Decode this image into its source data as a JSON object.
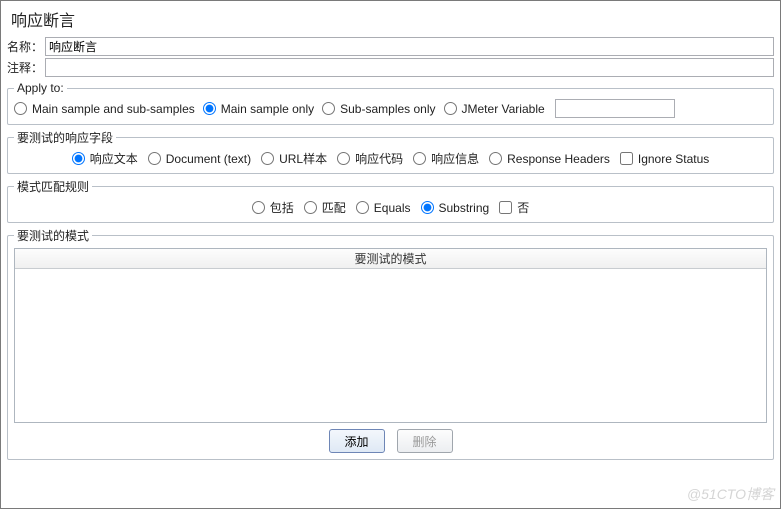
{
  "title": "响应断言",
  "fields": {
    "name_label": "名称：",
    "name_value": "响应断言",
    "comment_label": "注释：",
    "comment_value": ""
  },
  "apply_to": {
    "legend": "Apply to:",
    "options": [
      {
        "label": "Main sample and sub-samples",
        "selected": false
      },
      {
        "label": "Main sample only",
        "selected": true
      },
      {
        "label": "Sub-samples only",
        "selected": false
      },
      {
        "label": "JMeter Variable",
        "selected": false
      }
    ],
    "variable_value": ""
  },
  "response_field": {
    "legend": "要测试的响应字段",
    "options": [
      {
        "label": "响应文本",
        "selected": true
      },
      {
        "label": "Document (text)",
        "selected": false
      },
      {
        "label": "URL样本",
        "selected": false
      },
      {
        "label": "响应代码",
        "selected": false
      },
      {
        "label": "响应信息",
        "selected": false
      },
      {
        "label": "Response Headers",
        "selected": false
      }
    ],
    "ignore_status_label": "Ignore Status",
    "ignore_status_checked": false
  },
  "match_rule": {
    "legend": "模式匹配规则",
    "options": [
      {
        "label": "包括",
        "selected": false
      },
      {
        "label": "匹配",
        "selected": false
      },
      {
        "label": "Equals",
        "selected": false
      },
      {
        "label": "Substring",
        "selected": true
      }
    ],
    "not_label": "否",
    "not_checked": false
  },
  "patterns": {
    "legend": "要测试的模式",
    "table_header": "要测试的模式",
    "rows": []
  },
  "buttons": {
    "add": "添加",
    "delete": "删除"
  },
  "watermark": "@51CTO博客"
}
